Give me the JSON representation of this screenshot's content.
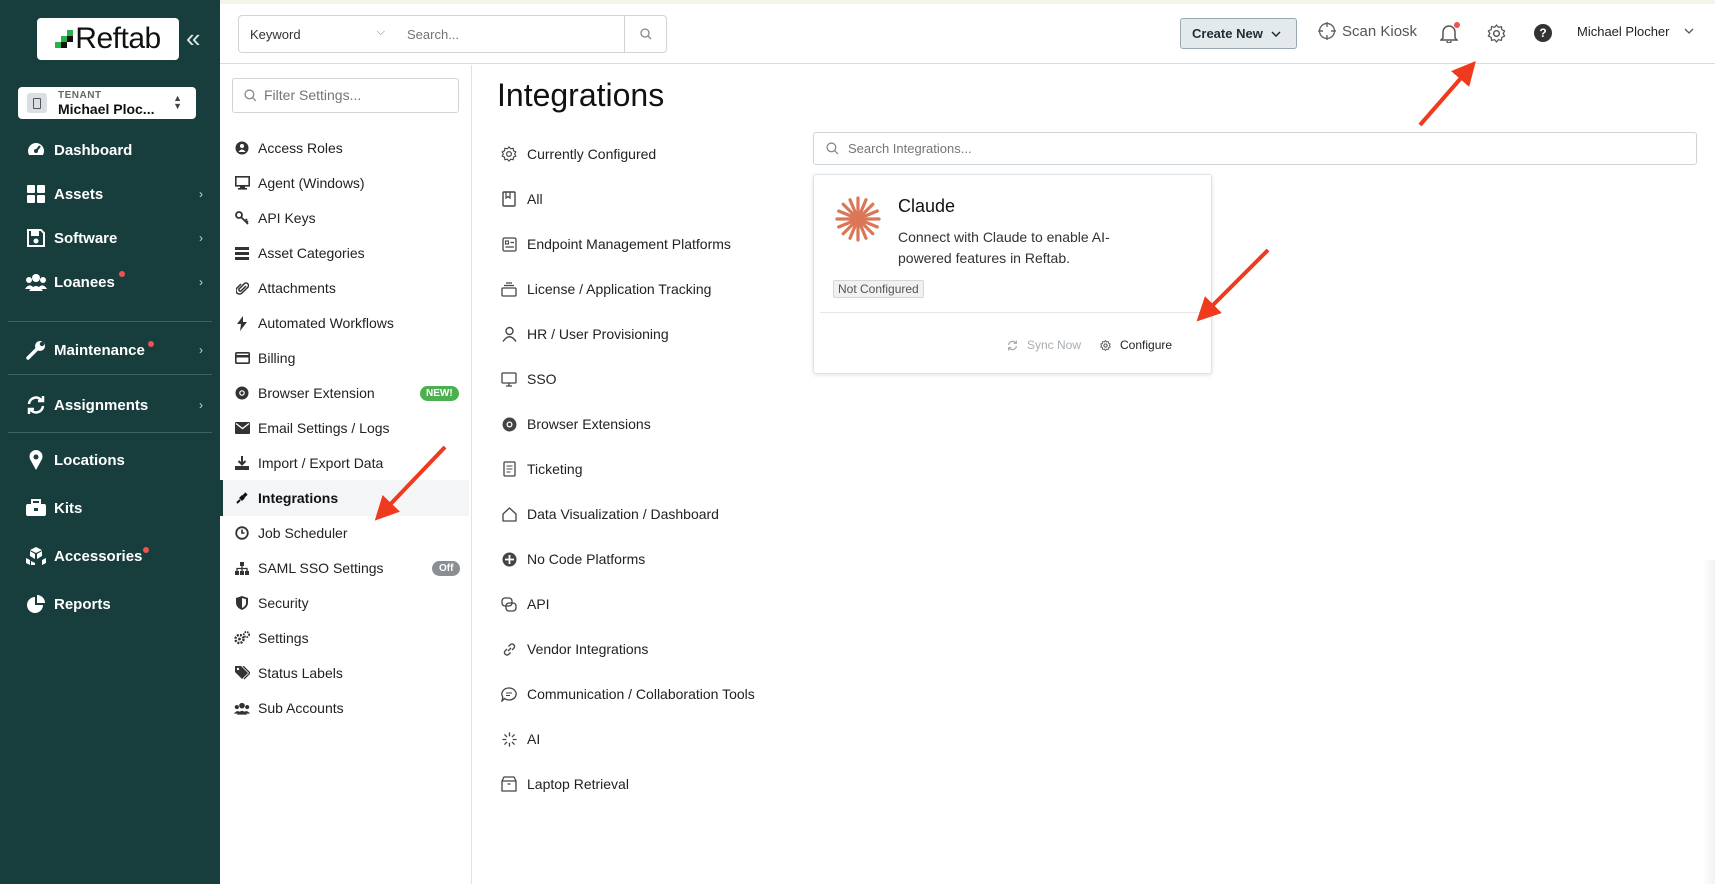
{
  "app": {
    "logo_text": "Reftab",
    "brand_colors": {
      "sidebar": "#173d3d",
      "accent_red": "#ef3a1d",
      "claude": "#d97757"
    }
  },
  "tenant": {
    "label": "TENANT",
    "name": "Michael Ploc..."
  },
  "sidebar": {
    "items": [
      {
        "label": "Dashboard",
        "icon": "gauge-icon"
      },
      {
        "label": "Assets",
        "icon": "grid-icon"
      },
      {
        "label": "Software",
        "icon": "floppy-disk-icon"
      },
      {
        "label": "Loanees",
        "icon": "users-icon"
      },
      {
        "label": "Maintenance",
        "icon": "wrench-icon"
      },
      {
        "label": "Assignments",
        "icon": "sync-icon"
      },
      {
        "label": "Locations",
        "icon": "map-pin-icon"
      },
      {
        "label": "Kits",
        "icon": "briefcase-icon"
      },
      {
        "label": "Accessories",
        "icon": "boxes-icon"
      },
      {
        "label": "Reports",
        "icon": "pie-chart-icon"
      }
    ]
  },
  "topbar": {
    "search_type": "Keyword",
    "search_placeholder": "Search...",
    "create_new": "Create New",
    "scan_kiosk": "Scan Kiosk",
    "user_name": "Michael Plocher"
  },
  "settings": {
    "filter_placeholder": "Filter Settings...",
    "items": [
      {
        "label": "Access Roles"
      },
      {
        "label": "Agent (Windows)"
      },
      {
        "label": "API Keys"
      },
      {
        "label": "Asset Categories"
      },
      {
        "label": "Attachments"
      },
      {
        "label": "Automated Workflows"
      },
      {
        "label": "Billing"
      },
      {
        "label": "Browser Extension",
        "badge": "NEW!"
      },
      {
        "label": "Email Settings / Logs"
      },
      {
        "label": "Import / Export Data"
      },
      {
        "label": "Integrations",
        "active": true
      },
      {
        "label": "Job Scheduler"
      },
      {
        "label": "SAML SSO Settings",
        "badge": "Off"
      },
      {
        "label": "Security"
      },
      {
        "label": "Settings"
      },
      {
        "label": "Status Labels"
      },
      {
        "label": "Sub Accounts"
      }
    ]
  },
  "main": {
    "title": "Integrations",
    "categories": [
      {
        "label": "Currently Configured"
      },
      {
        "label": "All"
      },
      {
        "label": "Endpoint Management Platforms"
      },
      {
        "label": "License / Application Tracking"
      },
      {
        "label": "HR / User Provisioning"
      },
      {
        "label": "SSO"
      },
      {
        "label": "Browser Extensions"
      },
      {
        "label": "Ticketing"
      },
      {
        "label": "Data Visualization / Dashboard"
      },
      {
        "label": "No Code Platforms"
      },
      {
        "label": "API"
      },
      {
        "label": "Vendor Integrations"
      },
      {
        "label": "Communication / Collaboration Tools"
      },
      {
        "label": "AI"
      },
      {
        "label": "Laptop Retrieval"
      }
    ],
    "search_placeholder": "Search Integrations...",
    "card": {
      "title": "Claude",
      "description": "Connect with Claude to enable AI-powered features in Reftab.",
      "status": "Not Configured",
      "sync_label": "Sync Now",
      "configure_label": "Configure"
    }
  }
}
